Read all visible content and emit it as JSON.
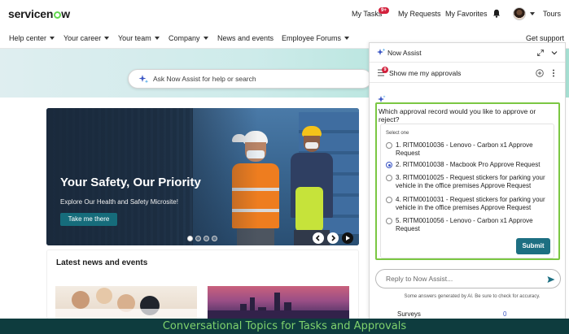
{
  "brand": {
    "logo_text": "servicenow"
  },
  "header": {
    "my_tasks": "My Tasks",
    "tasks_badge": "9+",
    "my_requests": "My Requests",
    "my_favorites": "My Favorites",
    "tours": "Tours"
  },
  "nav": {
    "items": [
      {
        "label": "Help center"
      },
      {
        "label": "Your career"
      },
      {
        "label": "Your team"
      },
      {
        "label": "Company"
      },
      {
        "label": "News and events"
      },
      {
        "label": "Employee Forums"
      }
    ],
    "get_support": "Get support"
  },
  "search": {
    "placeholder": "Ask Now Assist for help or search"
  },
  "banner": {
    "title": "Your Safety, Our Priority",
    "subtitle": "Explore Our Health and Safety Microsite!",
    "cta": "Take me there",
    "carousel_active_index": 0
  },
  "news": {
    "heading": "Latest news and events"
  },
  "assist": {
    "title": "Now Assist",
    "conversation_title": "Show me my approvals",
    "conversation_badge": "9",
    "question": "Which approval record would you like to approve or reject?",
    "select_label": "Select one",
    "options": [
      {
        "label": "1. RITM0010036 - Lenovo - Carbon x1 Approve Request",
        "selected": false
      },
      {
        "label": "2. RITM0010038 - Macbook Pro Approve Request",
        "selected": true
      },
      {
        "label": "3. RITM0010025 - Request stickers for parking your vehicle in the office premises Approve Request",
        "selected": false
      },
      {
        "label": "4. RITM0010031 - Request stickers for parking your vehicle in the office premises Approve Request",
        "selected": false
      },
      {
        "label": "5. RITM0010056 - Lenovo - Carbon x1 Approve Request",
        "selected": false
      }
    ],
    "submit_label": "Submit",
    "reply_placeholder": "Reply to Now Assist...",
    "disclaimer": "Some answers generated by AI. Be sure to check for accuracy.",
    "surveys_label": "Surveys",
    "surveys_count": "0"
  },
  "caption": "Conversational Topics for Tasks and Approvals",
  "colors": {
    "accent": "#1d6f82",
    "highlight_border": "#7bc743",
    "badge": "#d3203c",
    "caption_bg": "#0e3c3e",
    "caption_text": "#7fd26d"
  }
}
